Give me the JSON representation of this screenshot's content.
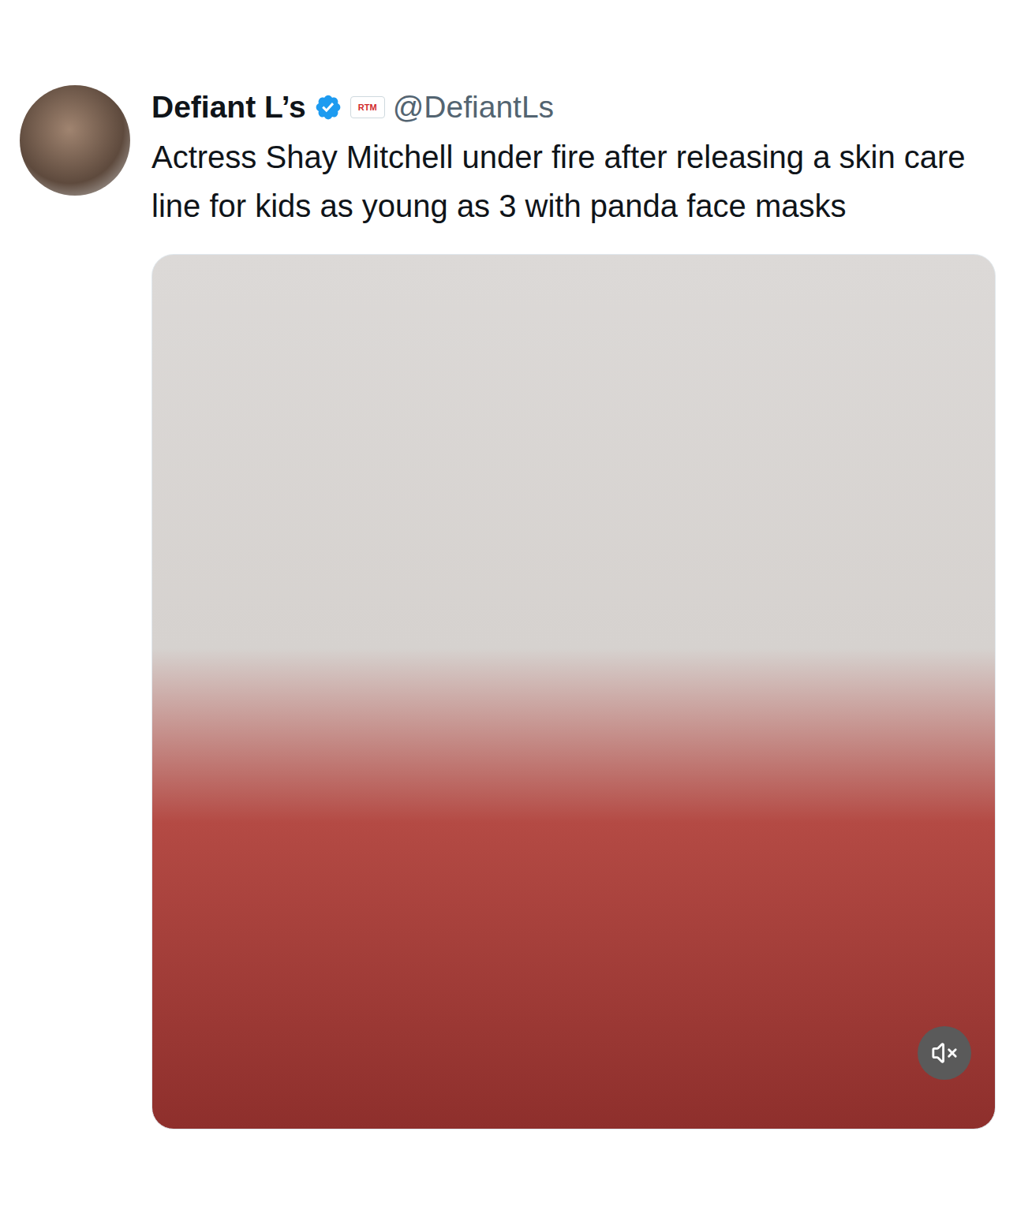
{
  "post": {
    "author": {
      "name": "Defiant L’s",
      "verified": true,
      "badge": "RTM",
      "handle": "@DefiantLs"
    },
    "text": "Actress Shay Mitchell under fire after releasing a skin care line for kids as young as 3 with panda face masks"
  },
  "media": {
    "kind": "video",
    "muted": true
  }
}
